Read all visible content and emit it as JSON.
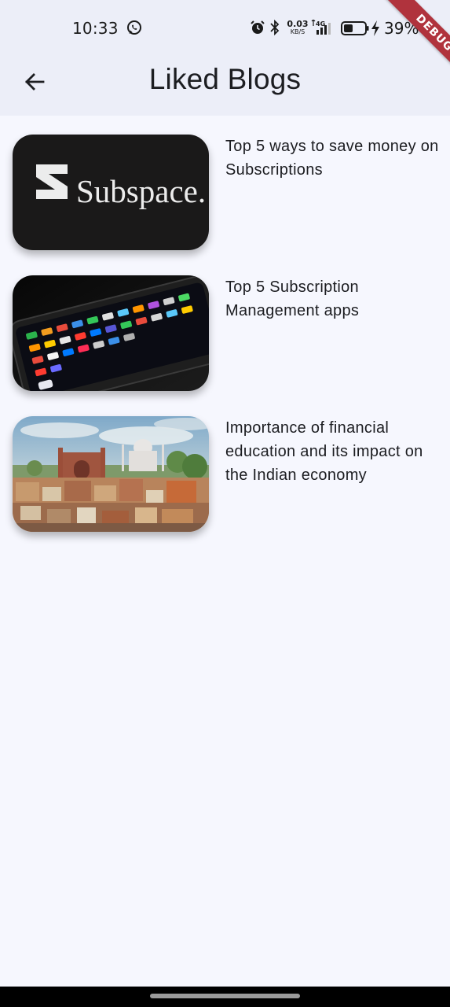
{
  "status_bar": {
    "time": "10:33",
    "net_speed_value": "0.03",
    "net_speed_unit": "KB/S",
    "network_type": "4G",
    "battery_percent": "39%",
    "icons": [
      "whatsapp-icon",
      "alarm-icon",
      "bluetooth-icon",
      "signal-icon",
      "battery-icon",
      "charging-icon"
    ]
  },
  "debug_banner": "DEBUG",
  "header": {
    "title": "Liked Blogs",
    "back_icon": "arrow-back-icon"
  },
  "blogs": [
    {
      "title": "Top 5 ways to save money on Subscriptions",
      "image": "subspace-logo-thumbnail",
      "image_text": "Subspace."
    },
    {
      "title": "Top 5 Subscription Management apps",
      "image": "smartphone-apps-thumbnail"
    },
    {
      "title": "Importance of financial education and its impact on the Indian economy",
      "image": "taj-mahal-city-thumbnail"
    }
  ],
  "colors": {
    "background": "#f6f7fe",
    "appbar": "#eceef8",
    "text": "#1c1d21",
    "debug_ribbon": "#b0333d"
  }
}
